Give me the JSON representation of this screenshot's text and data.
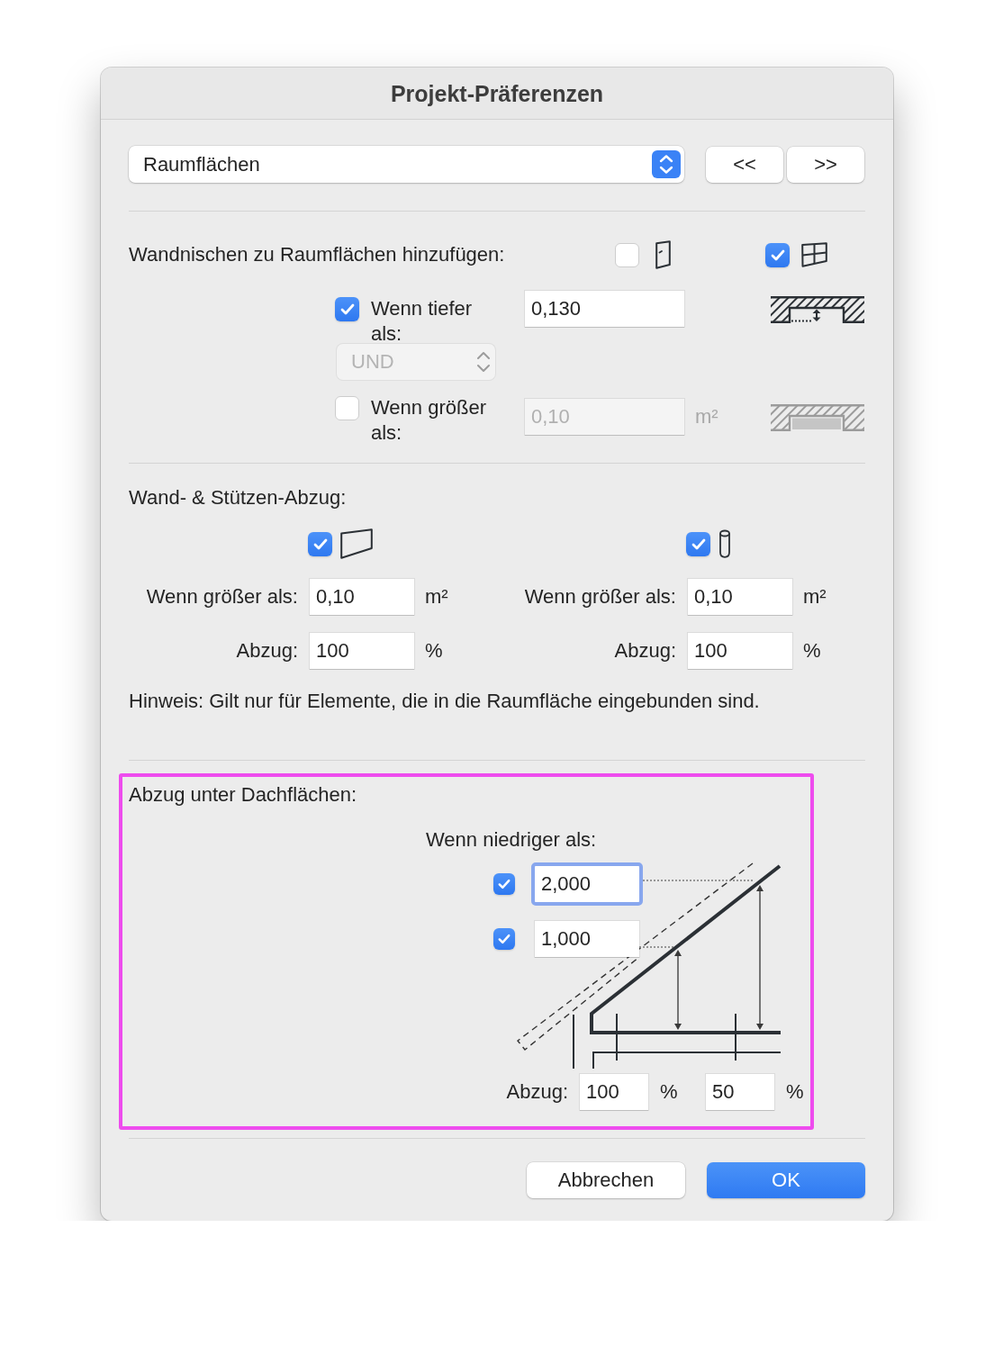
{
  "window": {
    "title": "Projekt-Präferenzen"
  },
  "page_selector": {
    "value": "Raumflächen"
  },
  "nav_buttons": [
    {
      "label": "<<"
    },
    {
      "label": ">>"
    }
  ],
  "wall_niches": {
    "label": "Wandnischen zu Raumflächen hinzufügen:",
    "options": [
      {
        "kind": "door",
        "checked": false
      },
      {
        "kind": "window",
        "checked": true
      }
    ],
    "conditions": [
      {
        "kind": "depth",
        "checked": true,
        "label": "Wenn tiefer als:",
        "value": "0,130",
        "disabled": false
      },
      {
        "kind": "area",
        "checked": false,
        "label": "Wenn größer als:",
        "value": "0,10",
        "unit": "m²",
        "disabled": true
      }
    ],
    "operator": {
      "value": "UND",
      "disabled": true
    }
  },
  "wall_column_deduction": {
    "label": "Wand- & Stützen-Abzug:",
    "groups": [
      {
        "kind": "wall",
        "checked": true,
        "threshold_label": "Wenn größer als:",
        "threshold": "0,10",
        "threshold_unit": "m²",
        "deduction_label": "Abzug:",
        "deduction": "100",
        "deduction_unit": "%"
      },
      {
        "kind": "column",
        "checked": true,
        "threshold_label": "Wenn größer als:",
        "threshold": "0,10",
        "threshold_unit": "m²",
        "deduction_label": "Abzug:",
        "deduction": "100",
        "deduction_unit": "%"
      }
    ],
    "note": "Hinweis: Gilt nur für Elemente, die in die Raumfläche eingebunden sind."
  },
  "roof_deduction": {
    "highlighted": true,
    "label": "Abzug unter Dachflächen:",
    "heights_label": "Wenn niedriger als:",
    "heights": [
      {
        "checked": true,
        "value": "2,000",
        "focused": true
      },
      {
        "checked": true,
        "value": "1,000",
        "focused": false
      }
    ],
    "deduction_label": "Abzug:",
    "deductions": [
      {
        "value": "100",
        "unit": "%"
      },
      {
        "value": "50",
        "unit": "%"
      }
    ]
  },
  "buttons": [
    {
      "kind": "cancel",
      "label": "Abbrechen"
    },
    {
      "kind": "default",
      "label": "OK"
    }
  ]
}
